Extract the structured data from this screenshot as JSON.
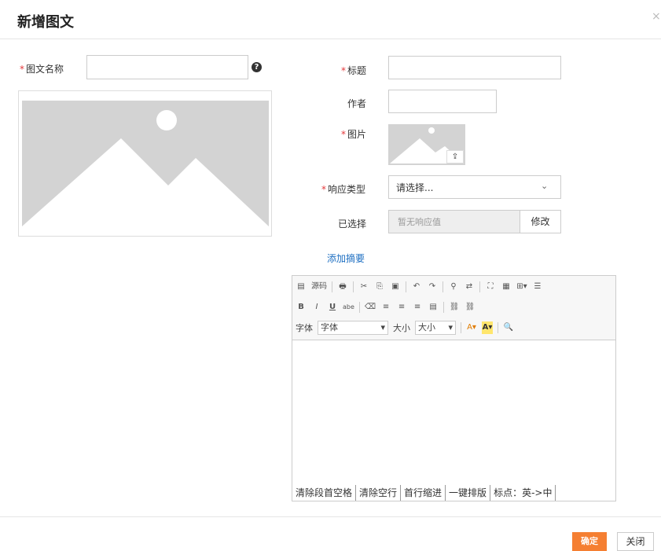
{
  "dialog": {
    "title": "新增图文",
    "close_glyph": "×"
  },
  "left": {
    "name_label": "图文名称",
    "name_value": "",
    "help_glyph": "?"
  },
  "form": {
    "title_label": "标题",
    "title_value": "",
    "author_label": "作者",
    "author_value": "",
    "image_label": "图片",
    "upload_glyph": "⇪",
    "response_type_label": "响应类型",
    "response_type_value": "请选择...",
    "selected_label": "已选择",
    "selected_placeholder": "暂无响应值",
    "modify_label": "修改",
    "add_summary_link": "添加摘要"
  },
  "editor": {
    "row1": [
      "源码",
      "打印",
      "剪切",
      "复制",
      "粘贴",
      "撤销",
      "重做",
      "查找",
      "替换",
      "全屏",
      "图片",
      "表格",
      "分隔线"
    ],
    "row2": [
      "B",
      "I",
      "U",
      "abe",
      "橡皮",
      "左对齐",
      "居中",
      "右对齐",
      "两端对齐",
      "链接",
      "取消链接"
    ],
    "font_label": "字体",
    "font_select": "字体",
    "size_label": "大小",
    "size_select": "大小",
    "bottom_tools": [
      "清除段首空格",
      "清除空行",
      "首行缩进",
      "一键排版",
      "标点：英->中"
    ]
  },
  "footer": {
    "ok_label": "确定",
    "close_label": "关闭"
  },
  "colors": {
    "required": "#e4393c",
    "link": "#1e6fc2",
    "primary_button": "#f57f32"
  }
}
